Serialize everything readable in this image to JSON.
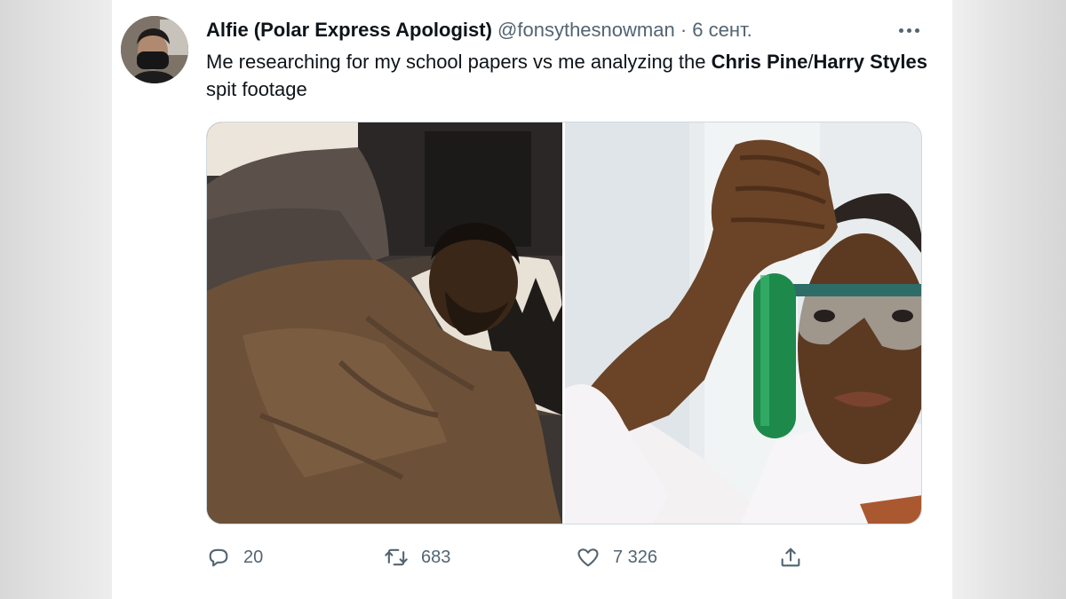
{
  "tweet": {
    "display_name": "Alfie (Polar Express Apologist)",
    "handle": "@fonsythesnowman",
    "separator": "·",
    "date": "6 сент.",
    "text": {
      "part1": "Me researching for my school papers vs me analyzing the ",
      "bold1": "Chris Pine",
      "slash": "/",
      "bold2": "Harry Styles",
      "part2": " spit footage"
    },
    "media": [
      {
        "name": "sleeping-man-photo"
      },
      {
        "name": "scientist-test-tube-photo"
      }
    ],
    "actions": {
      "reply": {
        "icon": "reply-icon",
        "count": "20"
      },
      "retweet": {
        "icon": "retweet-icon",
        "count": "683"
      },
      "like": {
        "icon": "heart-icon",
        "count": "7 326"
      },
      "share": {
        "icon": "share-icon"
      }
    }
  },
  "colors": {
    "text": "#0f1419",
    "secondary": "#536471",
    "border": "#cfd9de"
  }
}
